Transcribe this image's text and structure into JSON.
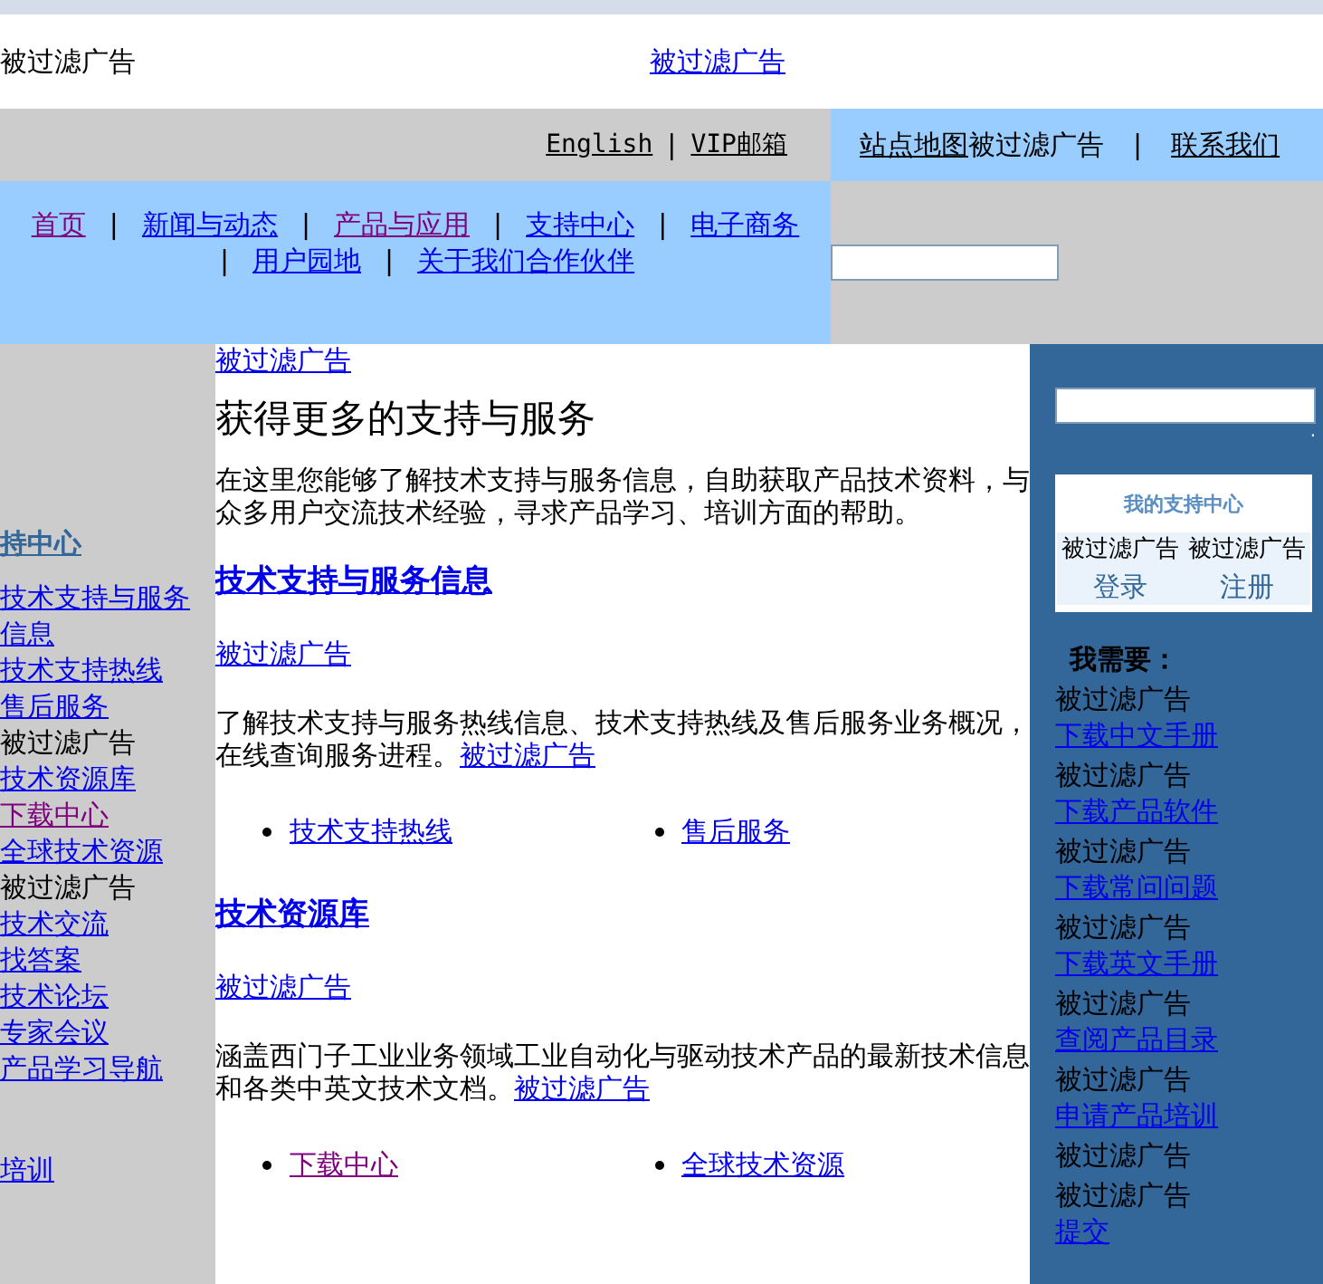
{
  "top_banner": {
    "left_text": "被过滤广告",
    "center_link": "被过滤广告"
  },
  "utility_bar": {
    "links": [
      {
        "kind": "link",
        "text": "English"
      },
      {
        "kind": "separator",
        "text": "|"
      },
      {
        "kind": "link",
        "text": "VIP邮箱"
      }
    ],
    "right_links": [
      {
        "kind": "link",
        "text": "站点地图"
      },
      {
        "kind": "text",
        "text": "被过滤广告"
      },
      {
        "kind": "separator",
        "text": "|"
      },
      {
        "kind": "link",
        "text": "联系我们"
      }
    ]
  },
  "nav": {
    "items": [
      {
        "kind": "link",
        "text": "首页",
        "visited": true
      },
      {
        "kind": "separator",
        "text": "|"
      },
      {
        "kind": "link",
        "text": "新闻与动态",
        "visited": false
      },
      {
        "kind": "separator",
        "text": "|"
      },
      {
        "kind": "link",
        "text": "产品与应用",
        "visited": true
      },
      {
        "kind": "separator",
        "text": "|"
      },
      {
        "kind": "link",
        "text": "支持中心",
        "visited": false
      },
      {
        "kind": "separator",
        "text": "|"
      },
      {
        "kind": "link",
        "text": "电子商务",
        "visited": false
      },
      {
        "kind": "separator",
        "text": "|"
      },
      {
        "kind": "link",
        "text": "用户园地",
        "visited": false
      },
      {
        "kind": "separator",
        "text": "|"
      },
      {
        "kind": "link",
        "text": "关于我们",
        "visited": false
      },
      {
        "kind": "link",
        "text": "合作伙伴",
        "visited": false
      }
    ]
  },
  "sidebar": {
    "title": "持中心",
    "items": [
      {
        "kind": "link",
        "text": "技术支持与服务信息",
        "visited": false
      },
      {
        "kind": "link",
        "text": "技术支持热线",
        "visited": false
      },
      {
        "kind": "link",
        "text": "售后服务",
        "visited": false
      },
      {
        "kind": "text",
        "text": "被过滤广告"
      },
      {
        "kind": "link",
        "text": "技术资源库",
        "visited": false
      },
      {
        "kind": "link",
        "text": "下载中心",
        "visited": true
      },
      {
        "kind": "link",
        "text": "全球技术资源",
        "visited": false
      },
      {
        "kind": "text",
        "text": "被过滤广告"
      },
      {
        "kind": "link",
        "text": "技术交流",
        "visited": false
      },
      {
        "kind": "link",
        "text": "找答案",
        "visited": false
      },
      {
        "kind": "link",
        "text": "技术论坛",
        "visited": false
      },
      {
        "kind": "link",
        "text": "专家会议",
        "visited": false
      },
      {
        "kind": "link",
        "text": "产品学习导航",
        "visited": false
      },
      {
        "kind": "gap"
      },
      {
        "kind": "link",
        "text": "培训",
        "visited": false
      }
    ]
  },
  "main": {
    "top_link": "被过滤广告",
    "title": "获得更多的支持与服务",
    "intro": "在这里您能够了解技术支持与服务信息，自助获取产品技术资料，与众多用户交流技术经验，寻求产品学习、培训方面的帮助。",
    "sections": [
      {
        "heading": "技术支持与服务信息",
        "ad_link": "被过滤广告",
        "text": "了解技术支持与服务热线信息、技术支持热线及售后服务业务概况，在线查询服务进程。",
        "text_link": "被过滤广告",
        "links": [
          {
            "text": "技术支持热线",
            "visited": false
          },
          {
            "text": "售后服务",
            "visited": false
          }
        ]
      },
      {
        "heading": "技术资源库",
        "ad_link": "被过滤广告",
        "text": "涵盖西门子工业业务领域工业自动化与驱动技术产品的最新技术信息和各类中英文技术文档。",
        "text_link": "被过滤广告",
        "links": [
          {
            "text": "下载中心",
            "visited": true
          },
          {
            "text": "全球技术资源",
            "visited": false
          }
        ]
      }
    ]
  },
  "right_panel": {
    "dot": ".",
    "support_box": {
      "title": "我的支持中心",
      "cells": [
        {
          "text": "被过滤广告",
          "link": "登录"
        },
        {
          "text": "被过滤广告",
          "link": "注册"
        }
      ]
    },
    "needs_title": "我需要：",
    "needs": [
      {
        "text": "被过滤广告",
        "link": "下载中文手册"
      },
      {
        "text": "被过滤广告",
        "link": "下载产品软件"
      },
      {
        "text": "被过滤广告",
        "link": "下载常问问题"
      },
      {
        "text": "被过滤广告",
        "link": "下载英文手册"
      },
      {
        "text": "被过滤广告",
        "link": "查阅产品目录"
      },
      {
        "text": "被过滤广告",
        "link": "申请产品培训"
      },
      {
        "text": "被过滤广告"
      },
      {
        "text": "被过滤广告",
        "link": "提交"
      }
    ]
  }
}
